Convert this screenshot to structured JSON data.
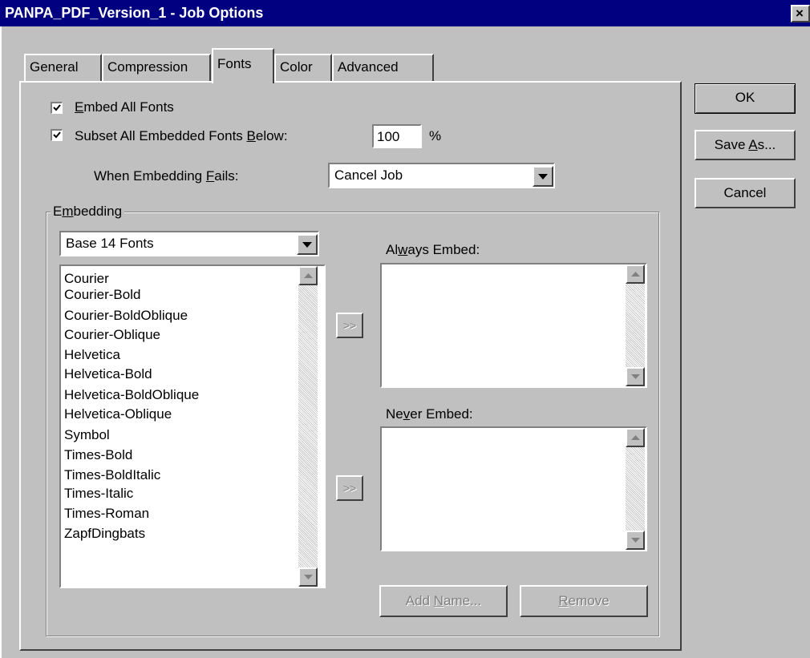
{
  "window": {
    "title": "PANPA_PDF_Version_1 - Job Options",
    "close_glyph": "×"
  },
  "tabs": [
    {
      "label": "General"
    },
    {
      "label": "Compression"
    },
    {
      "label": "Fonts",
      "active": true
    },
    {
      "label": "Color"
    },
    {
      "label": "Advanced"
    }
  ],
  "fonts_tab": {
    "embed_all": {
      "pre": "",
      "accel": "E",
      "post": "mbed All Fonts",
      "checked": true
    },
    "subset": {
      "pre": "Subset All Embedded Fonts ",
      "accel": "B",
      "post": "elow:",
      "checked": true,
      "value": "100",
      "unit": "%"
    },
    "when_fails": {
      "pre": "When Embedding ",
      "accel": "F",
      "post": "ails:",
      "value": "Cancel Job"
    },
    "embedding_group": {
      "pre": "E",
      "accel": "m",
      "post": "bedding",
      "font_set": "Base 14 Fonts",
      "font_list": [
        "Courier",
        "Courier-Bold",
        "Courier-BoldOblique",
        "Courier-Oblique",
        "Helvetica",
        "Helvetica-Bold",
        "Helvetica-BoldOblique",
        "Helvetica-Oblique",
        "Symbol",
        "Times-Bold",
        "Times-BoldItalic",
        "Times-Italic",
        "Times-Roman",
        "ZapfDingbats"
      ],
      "move_button_label": ">>",
      "always_embed": {
        "pre": "Al",
        "accel": "w",
        "post": "ays Embed:"
      },
      "never_embed": {
        "pre": "Ne",
        "accel": "v",
        "post": "er Embed:"
      },
      "add_name": {
        "pre": "Add ",
        "accel": "N",
        "post": "ame..."
      },
      "remove": {
        "pre": "",
        "accel": "R",
        "post": "emove"
      }
    }
  },
  "side_buttons": {
    "ok": "OK",
    "save_as": {
      "pre": "Save ",
      "accel": "A",
      "post": "s..."
    },
    "cancel": "Cancel"
  },
  "icons": {
    "check": "checkmark-icon",
    "dropdown": "chevron-down-icon",
    "scroll_up": "scroll-up-icon",
    "scroll_down": "scroll-down-icon"
  },
  "colors": {
    "title_bar": "#000080",
    "face": "#c0c0c0"
  }
}
